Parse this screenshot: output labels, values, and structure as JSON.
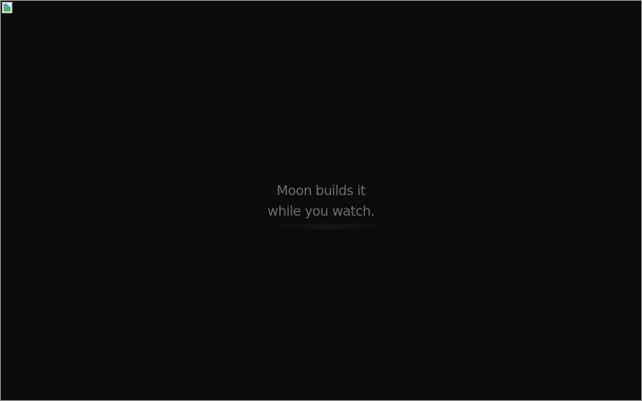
{
  "hero": {
    "line1": "Moon builds it",
    "line2": "while you watch."
  },
  "icons": {
    "broken_image": "broken-image-icon"
  },
  "colors": {
    "background": "#0b0b0b",
    "text": "#6e6e6e",
    "border": "#8a8a8a"
  }
}
